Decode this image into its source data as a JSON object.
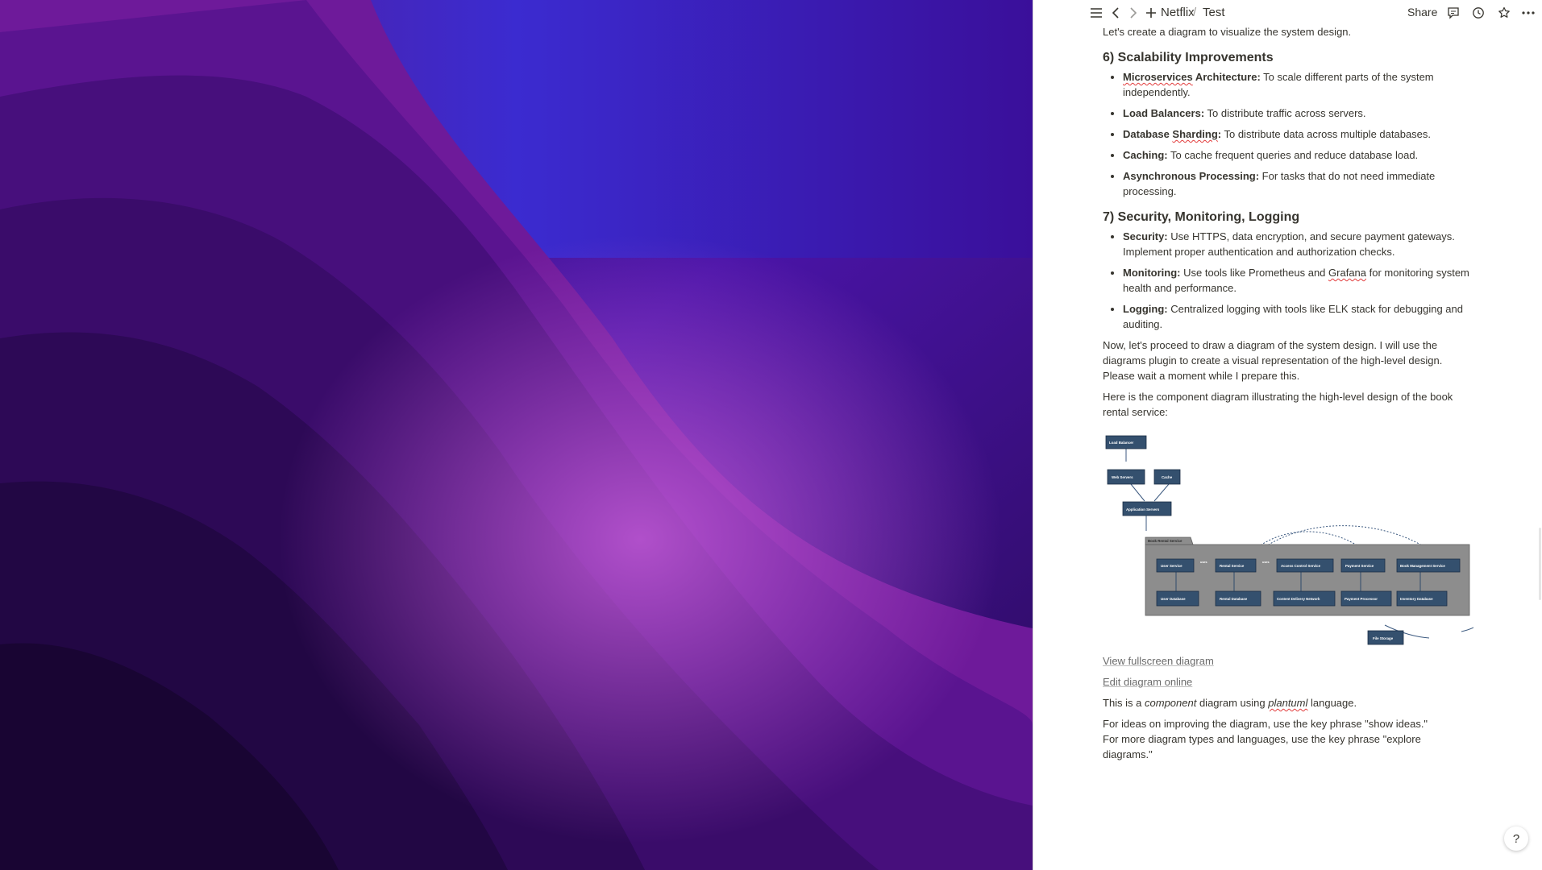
{
  "topbar": {
    "workspace": "Netflix",
    "separator": "/",
    "page": "Test",
    "share_label": "Share",
    "icons": [
      "menu-icon",
      "back-icon",
      "forward-icon",
      "plus-icon",
      "comment-icon",
      "history-icon",
      "star-icon",
      "more-icon"
    ]
  },
  "doc": {
    "intro": "Let's create a diagram to visualize the system design.",
    "sec6": {
      "heading": "6) Scalability Improvements",
      "items": [
        {
          "term_a": "Microservices",
          "term_b": " Architecture:",
          "desc": " To scale different parts of the system independently."
        },
        {
          "term": "Load Balancers:",
          "desc": " To distribute traffic across servers."
        },
        {
          "term_a": "Database ",
          "term_b": "Sharding",
          "term_c": ":",
          "desc": " To distribute data across multiple databases."
        },
        {
          "term": "Caching:",
          "desc": " To cache frequent queries and reduce database load."
        },
        {
          "term": "Asynchronous Processing:",
          "desc": " For tasks that do not need immediate processing."
        }
      ]
    },
    "sec7": {
      "heading": "7) Security, Monitoring, Logging",
      "items": [
        {
          "term": "Security:",
          "desc": " Use HTTPS, data encryption, and secure payment gateways. Implement proper authentication and authorization checks."
        },
        {
          "term": "Monitoring:",
          "desc_a": " Use tools like Prometheus and ",
          "desc_b": "Grafana",
          "desc_c": " for monitoring system health and performance."
        },
        {
          "term": "Logging:",
          "desc": " Centralized logging with tools like ELK stack for debugging and auditing."
        }
      ]
    },
    "para_proceed": "Now, let's proceed to draw a diagram of the system design. I will use the diagrams plugin to create a visual representation of the high-level design. Please wait a moment while I prepare this.",
    "para_here": "Here is the component diagram illustrating the high-level design of the book rental service:",
    "link_fullscreen": "View fullscreen diagram",
    "link_edit": "Edit diagram online",
    "component_a": "This is a ",
    "component_b": "component",
    "component_c": " diagram using ",
    "component_d": "plantuml",
    "component_e": " language.",
    "ideas_line1": "For ideas on improving the diagram, use the key phrase \"show ideas.\"",
    "ideas_line2": "For more diagram types and languages, use the key phrase \"explore diagrams.\"",
    "help_label": "?"
  },
  "diagram": {
    "package_label": "Book Rental Service",
    "top_nodes": [
      "Load Balancer",
      "Web Servers",
      "Cache",
      "Application Servers"
    ],
    "services": [
      "User Service",
      "Rental Service",
      "Access Control Service",
      "Payment Service",
      "Book Management Service"
    ],
    "stores": [
      "User Database",
      "Rental Database",
      "Content Delivery Network",
      "Payment Processor",
      "Inventory Database"
    ],
    "storage": "File Storage",
    "edge_label": "uses"
  },
  "colors": {
    "node_fill": "#34506e",
    "package_fill": "#8d8d8d",
    "accent_text": "#37352f",
    "spellcheck": "#e23d3d"
  }
}
